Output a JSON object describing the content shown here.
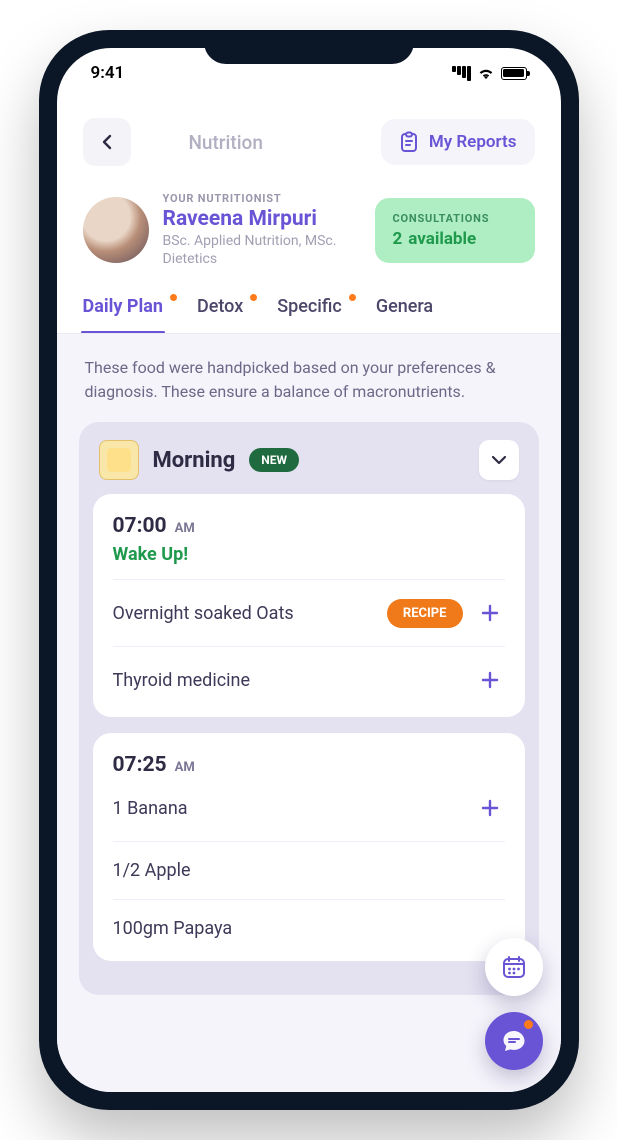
{
  "status": {
    "time": "9:41"
  },
  "header": {
    "title": "Nutrition",
    "reports_label": "My Reports"
  },
  "nutritionist": {
    "label": "YOUR NUTRITIONIST",
    "name": "Raveena Mirpuri",
    "credentials": "BSc. Applied Nutrition, MSc. Dietetics"
  },
  "consultations": {
    "label": "CONSULTATIONS",
    "count": "2",
    "suffix": "available"
  },
  "tabs": [
    {
      "label": "Daily Plan",
      "active": true,
      "dot": true
    },
    {
      "label": "Detox",
      "active": false,
      "dot": true
    },
    {
      "label": "Specific",
      "active": false,
      "dot": true
    },
    {
      "label": "Genera",
      "active": false,
      "dot": false
    }
  ],
  "intro": "These food were handpicked based on your preferences & diagnosis. These ensure a balance of macronutrients.",
  "section": {
    "title": "Morning",
    "badge": "NEW"
  },
  "slots": [
    {
      "time": "07:00",
      "ampm": "AM",
      "note": "Wake Up!",
      "items": [
        {
          "name": "Overnight soaked Oats",
          "recipe": true
        },
        {
          "name": "Thyroid medicine",
          "recipe": false
        }
      ]
    },
    {
      "time": "07:25",
      "ampm": "AM",
      "note": "",
      "items": [
        {
          "name": "1 Banana",
          "recipe": false
        },
        {
          "name": "1/2 Apple",
          "recipe": false
        },
        {
          "name": "100gm Papaya",
          "recipe": false
        }
      ]
    }
  ],
  "recipe_label": "RECIPE"
}
